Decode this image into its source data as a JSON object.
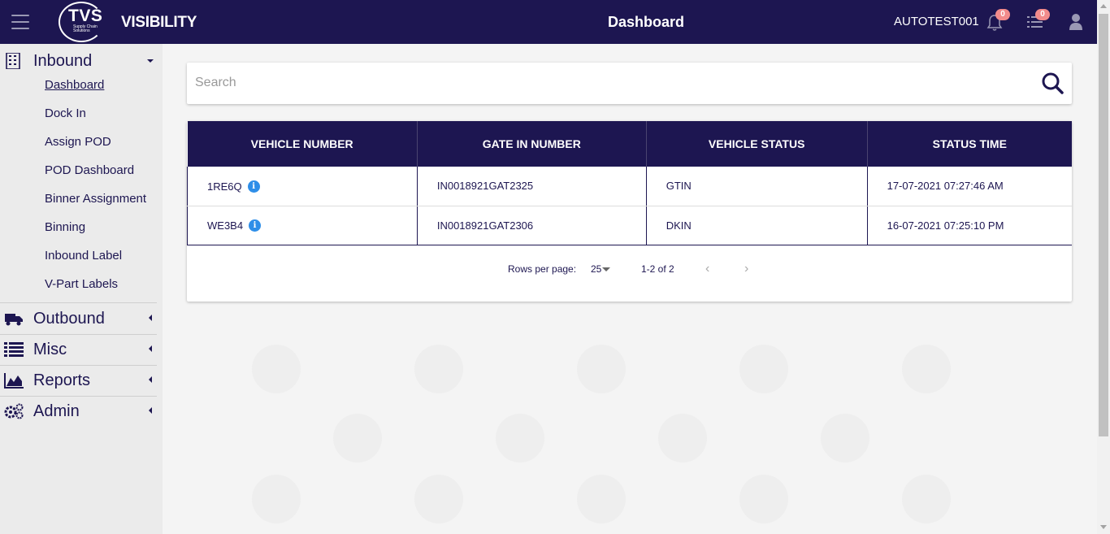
{
  "header": {
    "logo_text": "TVS",
    "logo_subtext": "Supply Chain Solutions",
    "brand": "VISIBILITY",
    "title": "Dashboard",
    "username": "AUTOTEST001",
    "notification_count": "0",
    "tasks_count": "0"
  },
  "sidebar": {
    "sections": [
      {
        "label": "Inbound",
        "expanded": true,
        "items": [
          "Dashboard",
          "Dock In",
          "Assign POD",
          "POD Dashboard",
          "Binner Assignment",
          "Binning",
          "Inbound Label",
          "V-Part Labels"
        ]
      },
      {
        "label": "Outbound"
      },
      {
        "label": "Misc"
      },
      {
        "label": "Reports"
      },
      {
        "label": "Admin"
      }
    ]
  },
  "search": {
    "placeholder": "Search",
    "value": ""
  },
  "table": {
    "columns": [
      "VEHICLE NUMBER",
      "GATE IN NUMBER",
      "VEHICLE STATUS",
      "STATUS TIME"
    ],
    "rows": [
      {
        "vehicle": "1RE6Q",
        "gate_in": "IN0018921GAT2325",
        "status": "GTIN",
        "time": "17-07-2021 07:27:46 AM"
      },
      {
        "vehicle": "WE3B4",
        "gate_in": "IN0018921GAT2306",
        "status": "DKIN",
        "time": "16-07-2021 07:25:10 PM"
      }
    ]
  },
  "pagination": {
    "rows_per_page_label": "Rows per page:",
    "rows_per_page": "25",
    "range": "1-2 of 2"
  },
  "colors": {
    "primary": "#1d1651",
    "badge": "#f28b8b",
    "info": "#2e8ee8"
  }
}
